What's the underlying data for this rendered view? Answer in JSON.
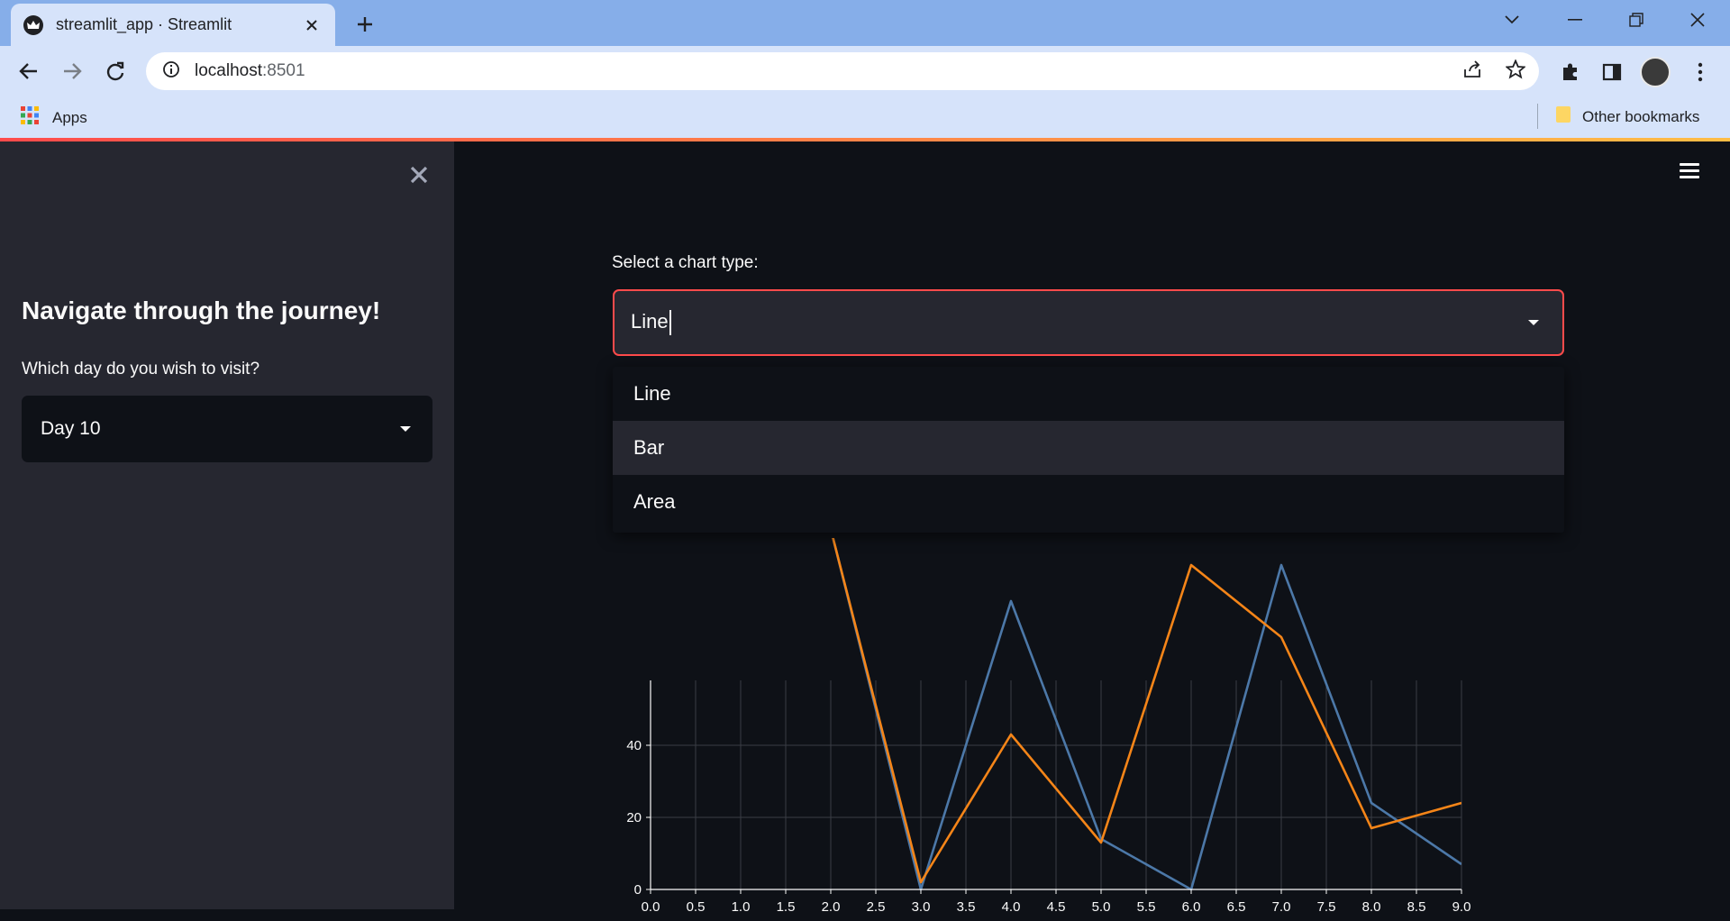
{
  "browser": {
    "tab_title": "streamlit_app · Streamlit",
    "url_host": "localhost",
    "url_port": ":8501",
    "bookmarks": {
      "apps_label": "Apps",
      "other_label": "Other bookmarks"
    }
  },
  "sidebar": {
    "title": "Navigate through the journey!",
    "day_label": "Which day do you wish to visit?",
    "day_value": "Day 10"
  },
  "main": {
    "chart_type_label": "Select a chart type:",
    "chart_type_value": "Line",
    "options": [
      "Line",
      "Bar",
      "Area"
    ],
    "hovered_option": "Bar"
  },
  "colors": {
    "accent": "#ff4b4b",
    "series_a": "#4c78a8",
    "series_b": "#f58518"
  },
  "chart_data": {
    "type": "line",
    "x": [
      0,
      1,
      2,
      3,
      4,
      5,
      6,
      7,
      8,
      9
    ],
    "x_ticks": [
      "0.0",
      "0.5",
      "1.0",
      "1.5",
      "2.0",
      "2.5",
      "3.0",
      "3.5",
      "4.0",
      "4.5",
      "5.0",
      "5.5",
      "6.0",
      "6.5",
      "7.0",
      "7.5",
      "8.0",
      "8.5",
      "9.0"
    ],
    "y_ticks": [
      "0",
      "20",
      "40"
    ],
    "xlim": [
      0,
      9
    ],
    "visible_ylim": [
      0,
      58
    ],
    "grid": true,
    "series": [
      {
        "values": [
          null,
          null,
          100,
          0,
          80,
          14,
          0,
          90,
          24,
          7
        ]
      },
      {
        "values": [
          null,
          null,
          100,
          2,
          43,
          13,
          90,
          70,
          17,
          24
        ]
      }
    ]
  }
}
